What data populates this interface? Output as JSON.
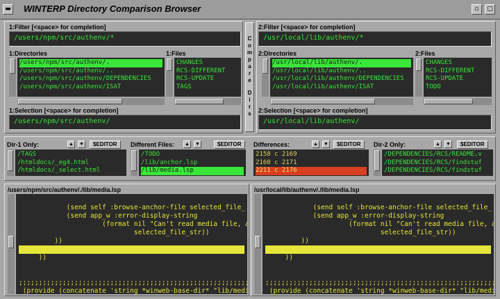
{
  "window": {
    "title": "WINTERP Directory Comparison Browser",
    "menu_glyph": "▬",
    "minimize_glyph": "▫",
    "maximize_glyph": "▢"
  },
  "left": {
    "filter_label": "1:Filter [<space> for completion]",
    "filter_value": "/users/npm/src/authenv/*",
    "dirs_label": "1:Directories",
    "dirs": [
      "/users/npm/src/authenv/.",
      "/users/npm/src/authenv/..",
      "/users/npm/src/authenv/DEPENDENCIES",
      "/users/npm/src/authenv/ISAT"
    ],
    "files_label": "1:Files",
    "files": [
      "CHANGES",
      "RCS-DIFFERENT",
      "RCS-UPDATE",
      "TAGS"
    ],
    "selection_label": "1:Selection [<space> for completion]",
    "selection_value": "/users/npm/src/authenv/"
  },
  "right": {
    "filter_label": "2:Filter [<space> for completion]",
    "filter_value": "/usr/local/lib/authenv/*",
    "dirs_label": "2:Directories",
    "dirs": [
      "/usr/local/lib/authenv/.",
      "/usr/local/lib/authenv/..",
      "/usr/local/lib/authenv/DEPENDENCIES",
      "/usr/local/lib/authenv/ISAT"
    ],
    "files_label": "2:Files",
    "files": [
      "CHANGES",
      "RCS-DIFFERENT",
      "RCS-UPDATE",
      "TODO"
    ],
    "selection_label": "2:Selection [<space> for completion]",
    "selection_value": "/usr/local/lib/authenv/"
  },
  "compare": {
    "letters": [
      "C",
      "o",
      "m",
      "p",
      "a",
      "r",
      "e",
      "",
      "D",
      "i",
      "r",
      "s"
    ]
  },
  "panes": {
    "up": "▲",
    "down": "▼",
    "editor": "$EDITOR",
    "dir1_label": "Dir-1 Only:",
    "dir1_items": [
      "/TAGS",
      "/htmldocs/_eg4.html",
      "/htmldocs/_select.html"
    ],
    "diff_files_label": "Different Files:",
    "diff_files_items": [
      "/TODO",
      "/lib/anchor.lsp",
      "/lib/media.lsp"
    ],
    "differences_label": "Differences:",
    "differences_items": [
      "2158 c 2169",
      "2160 c 2171",
      "2211 c 2176"
    ],
    "dir2_label": "Dir-2 Only:",
    "dir2_items": [
      "/DEPENDENCIES/RCS/README,v",
      "/DEPENDENCIES/RCS/findstuf",
      "/DEPENDENCIES/RCS/findstuf"
    ]
  },
  "editors": {
    "left_path": "/users/npm/src/authenv/./lib/media.lsp",
    "right_path": "/usr/local/lib/authenv/./lib/media.lsp",
    "lines": [
      "",
      "            (send self :browse-anchor-file selected_file_",
      "            (send app_w :error-display-string",
      "                     (format nil \"Can't read media file, ass",
      "                             selected_file_str))",
      "         ))",
      "",
      "     ))",
      "",
      "",
      ";;;;;;;;;;;;;;;;;;;;;;;;;;;;;;;;;;;;;;;;;;;;;;;;;;;;;;;;;;;",
      " (provide (concatenate 'string *winweb-base-dir* \"lib/medi"
    ]
  }
}
